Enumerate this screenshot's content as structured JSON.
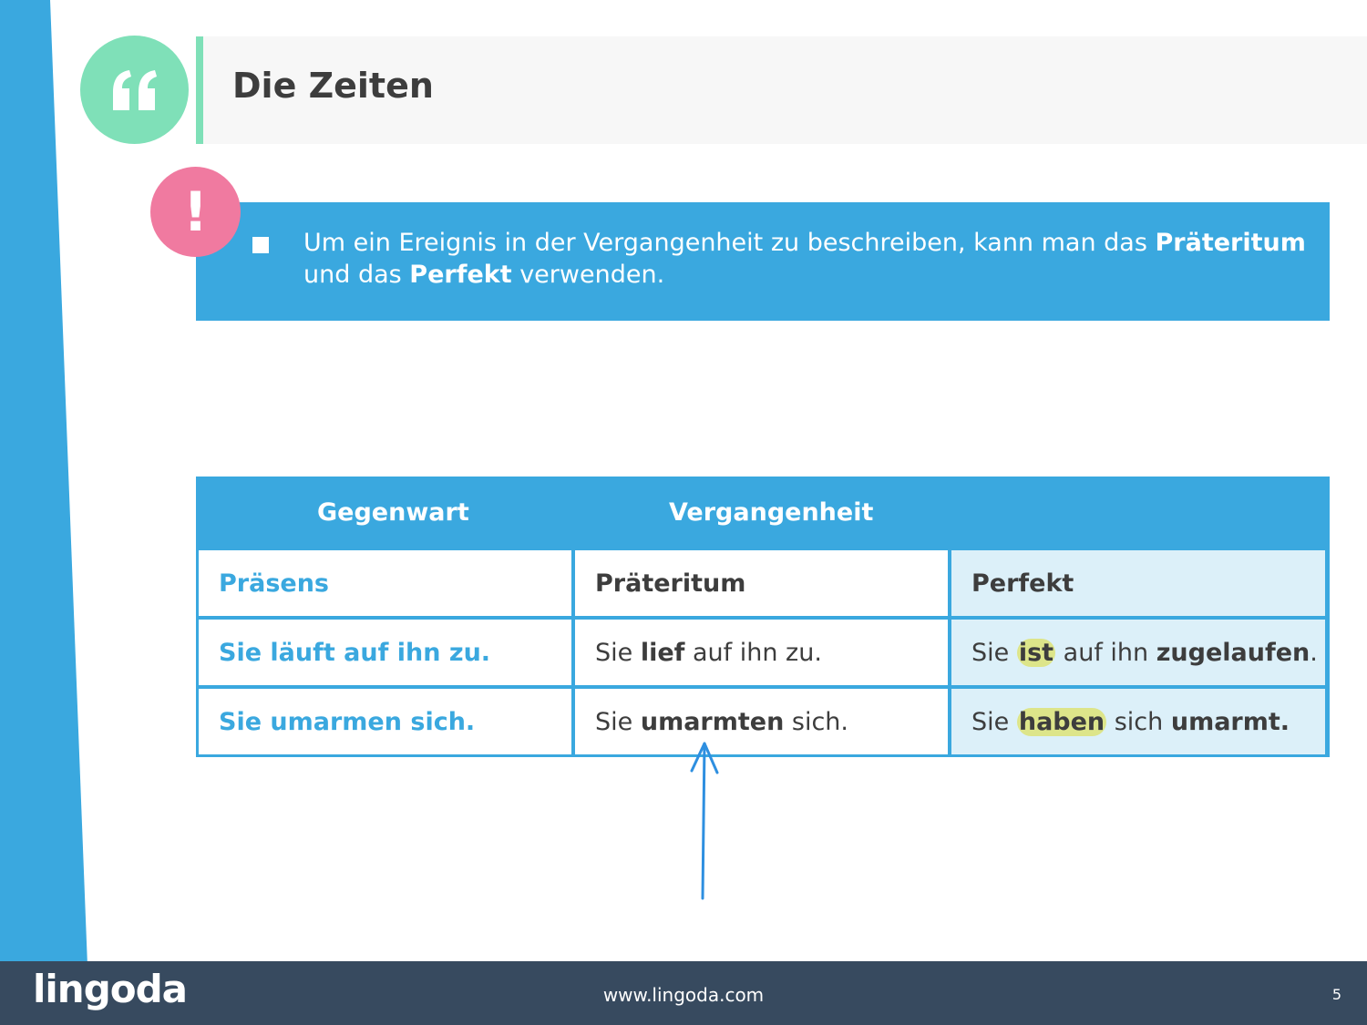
{
  "colors": {
    "accent_blue": "#3aa8df",
    "mint": "#7fe0b8",
    "pink": "#f07aa0",
    "highlight": "#dde58a",
    "footer": "#374a5f"
  },
  "header": {
    "icon": "quote-icon",
    "title": "Die Zeiten"
  },
  "info": {
    "icon": "exclamation-icon",
    "exclamation": "!",
    "text_part1": "Um ein Ereignis in der Vergangenheit zu beschreiben, kann man das ",
    "bold1": "Präteritum",
    "text_part2": " und das ",
    "bold2": "Perfekt",
    "text_part3": " verwenden."
  },
  "table": {
    "header_present": "Gegenwart",
    "header_past": "Vergangenheit",
    "col_headers": [
      "Präsens",
      "Präteritum",
      "Perfekt"
    ],
    "rows": [
      {
        "praesens": "Sie läuft auf ihn zu.",
        "praeteritum": {
          "pre": "Sie ",
          "verb": "lief",
          "post": " auf ihn zu."
        },
        "perfekt": {
          "pre": "Sie ",
          "aux": "ist",
          "mid": " auf ihn ",
          "part": "zugelaufen",
          "post": "."
        }
      },
      {
        "praesens": "Sie umarmen sich.",
        "praeteritum": {
          "pre": "Sie ",
          "verb": "umarmten",
          "post": " sich."
        },
        "perfekt": {
          "pre": "Sie ",
          "aux": "haben",
          "mid": " sich ",
          "part": "umarmt.",
          "post": ""
        }
      }
    ]
  },
  "footer": {
    "logo": "lingoda",
    "url": "www.lingoda.com",
    "page_number": "5"
  }
}
